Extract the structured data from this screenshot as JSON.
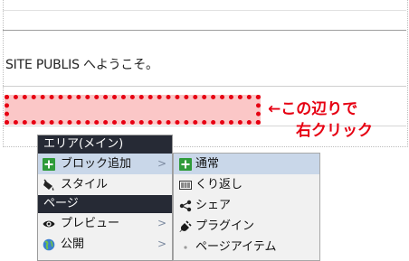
{
  "page": {
    "welcome_text": "SITE PUBLIS へようこそ。"
  },
  "annotation": {
    "line1": "←この辺りで",
    "line2": "右クリック",
    "accent_color": "#e60012"
  },
  "context_menu": {
    "sections": [
      {
        "header": "エリア(メイン)",
        "items": [
          {
            "label": "ブロック追加",
            "icon": "green-plus-icon",
            "has_submenu": true,
            "submenu_marker": ">"
          },
          {
            "label": "スタイル",
            "icon": "paint-bucket-icon",
            "has_submenu": false
          }
        ]
      },
      {
        "header": "ページ",
        "items": [
          {
            "label": "プレビュー",
            "icon": "eye-icon",
            "has_submenu": true,
            "submenu_marker": ">"
          },
          {
            "label": "公開",
            "icon": "globe-icon",
            "has_submenu": true,
            "submenu_marker": ">"
          }
        ]
      }
    ]
  },
  "submenu": {
    "items": [
      {
        "label": "通常",
        "icon": "green-plus-icon"
      },
      {
        "label": "くり返し",
        "icon": "repeat-box-icon"
      },
      {
        "label": "シェア",
        "icon": "share-icon"
      },
      {
        "label": "プラグイン",
        "icon": "plug-icon"
      },
      {
        "label": "ページアイテム",
        "icon": "dot-icon"
      }
    ]
  }
}
